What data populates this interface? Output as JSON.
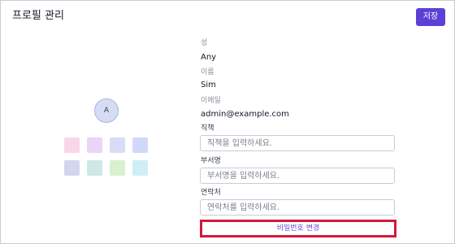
{
  "header": {
    "title": "프로필 관리",
    "save_label": "저장"
  },
  "profile": {
    "avatar_initial": "A",
    "swatch_colors": [
      "#f9d6ea",
      "#ead4f7",
      "#d9dcf7",
      "#d1d9fb",
      "#d2d6ef",
      "#cde8e6",
      "#d8f1cf",
      "#cfeef5"
    ]
  },
  "info": {
    "last_name_label": "성",
    "last_name_value": "Any",
    "first_name_label": "이름",
    "first_name_value": "Sim",
    "email_label": "이메일",
    "email_value": "admin@example.com"
  },
  "fields": {
    "job_title_label": "직책",
    "job_title_placeholder": "직책을 입력하세요.",
    "department_label": "부서명",
    "department_placeholder": "부서명을 입력하세요.",
    "contact_label": "연락처",
    "contact_placeholder": "연락처를 입력하세요."
  },
  "actions": {
    "change_password_label": "비밀번호 변경"
  },
  "colors": {
    "accent": "#5b3fd6",
    "highlight_border": "#d11a3a"
  }
}
